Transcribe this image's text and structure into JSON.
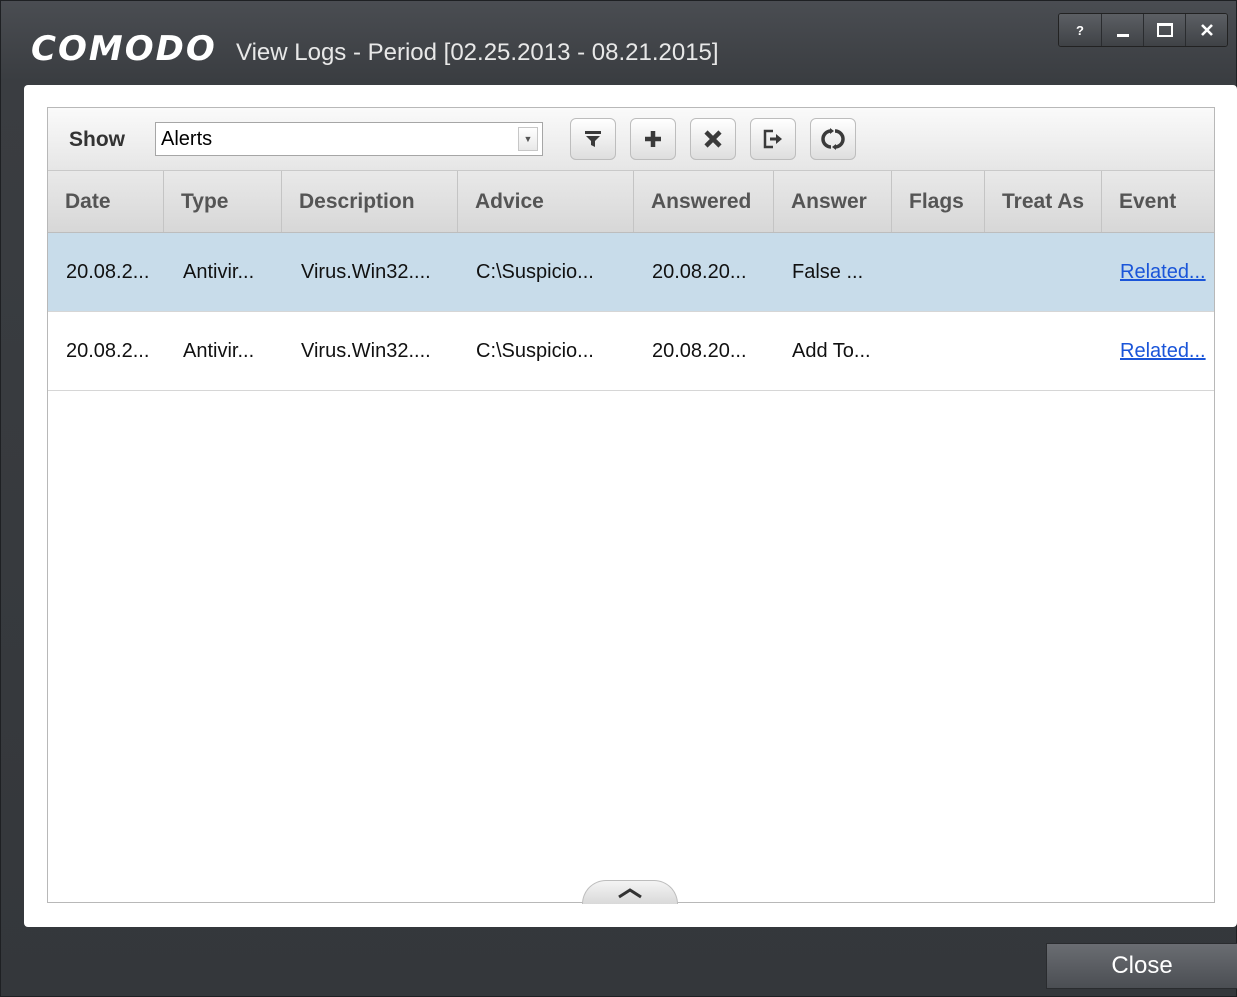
{
  "window": {
    "logo": "COMODO",
    "title": "View Logs - Period [02.25.2013 - 08.21.2015]",
    "controls": {
      "help": "?",
      "minimize": "–",
      "maximize": "□",
      "close": "×"
    }
  },
  "toolbar": {
    "show_label": "Show",
    "show_select": {
      "value": "Alerts"
    },
    "buttons": [
      "filter-icon",
      "add-icon",
      "remove-icon",
      "export-icon",
      "refresh-icon"
    ]
  },
  "table": {
    "columns": [
      "Date",
      "Type",
      "Description",
      "Advice",
      "Answered",
      "Answer",
      "Flags",
      "Treat As",
      "Event"
    ],
    "rows": [
      {
        "date": "20.08.2...",
        "type": "Antivir...",
        "description": "Virus.Win32....",
        "advice": "C:\\Suspicio...",
        "answered": "20.08.20...",
        "answer": "False ...",
        "flags": "",
        "treat_as": "",
        "event": "Related..."
      },
      {
        "date": "20.08.2...",
        "type": "Antivir...",
        "description": "Virus.Win32....",
        "advice": "C:\\Suspicio...",
        "answered": "20.08.20...",
        "answer": "Add To...",
        "flags": "",
        "treat_as": "",
        "event": "Related..."
      }
    ],
    "selected_row": 0
  },
  "footer": {
    "close_label": "Close"
  },
  "colors": {
    "selection": "#c8dcea",
    "link": "#1a55d9",
    "titlebar": "#3a3d41"
  }
}
